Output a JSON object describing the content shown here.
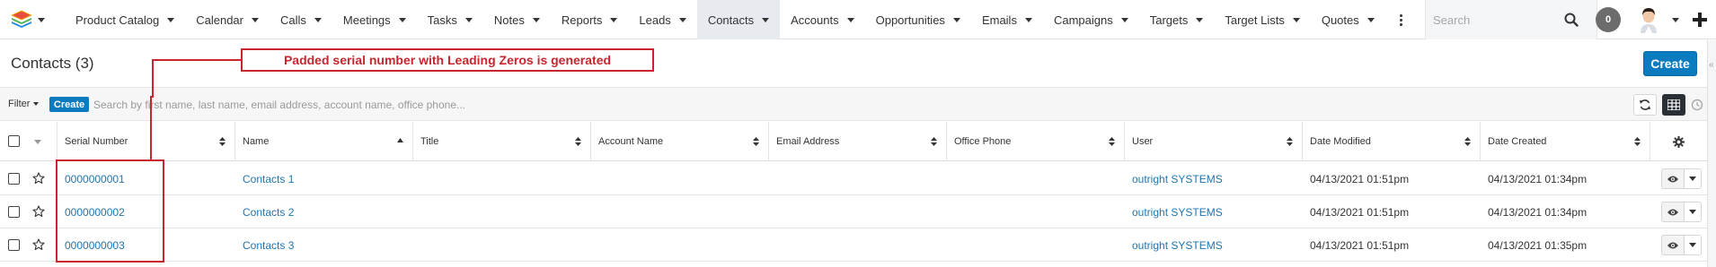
{
  "nav": {
    "items": [
      {
        "label": "Product Catalog",
        "active": false
      },
      {
        "label": "Calendar",
        "active": false
      },
      {
        "label": "Calls",
        "active": false
      },
      {
        "label": "Meetings",
        "active": false
      },
      {
        "label": "Tasks",
        "active": false
      },
      {
        "label": "Notes",
        "active": false
      },
      {
        "label": "Reports",
        "active": false
      },
      {
        "label": "Leads",
        "active": false
      },
      {
        "label": "Contacts",
        "active": true
      },
      {
        "label": "Accounts",
        "active": false
      },
      {
        "label": "Opportunities",
        "active": false
      },
      {
        "label": "Emails",
        "active": false
      },
      {
        "label": "Campaigns",
        "active": false
      },
      {
        "label": "Targets",
        "active": false
      },
      {
        "label": "Target Lists",
        "active": false
      },
      {
        "label": "Quotes",
        "active": false
      }
    ],
    "search_placeholder": "Search",
    "notification_count": "0"
  },
  "header": {
    "title": "Contacts (3)",
    "create_label": "Create"
  },
  "annotation": {
    "text": "Padded serial number with Leading Zeros is generated",
    "color": "#c7262e"
  },
  "filter_bar": {
    "filter_label": "Filter",
    "create_label": "Create",
    "search_placeholder": "Search by first name, last name, email address, account name, office phone..."
  },
  "table": {
    "columns": [
      {
        "label": "Serial Number"
      },
      {
        "label": "Name"
      },
      {
        "label": "Title"
      },
      {
        "label": "Account Name"
      },
      {
        "label": "Email Address"
      },
      {
        "label": "Office Phone"
      },
      {
        "label": "User"
      },
      {
        "label": "Date Modified"
      },
      {
        "label": "Date Created"
      }
    ],
    "rows": [
      {
        "serial": "0000000001",
        "name": "Contacts 1",
        "title": "",
        "account": "",
        "email": "",
        "phone": "",
        "user": "outright SYSTEMS",
        "modified": "04/13/2021 01:51pm",
        "created": "04/13/2021 01:34pm"
      },
      {
        "serial": "0000000002",
        "name": "Contacts 2",
        "title": "",
        "account": "",
        "email": "",
        "phone": "",
        "user": "outright SYSTEMS",
        "modified": "04/13/2021 01:51pm",
        "created": "04/13/2021 01:34pm"
      },
      {
        "serial": "0000000003",
        "name": "Contacts 3",
        "title": "",
        "account": "",
        "email": "",
        "phone": "",
        "user": "outright SYSTEMS",
        "modified": "04/13/2021 01:51pm",
        "created": "04/13/2021 01:35pm"
      }
    ]
  },
  "colors": {
    "accent": "#0b7bbf",
    "link": "#1f75b0",
    "annotation": "#c7262e"
  }
}
